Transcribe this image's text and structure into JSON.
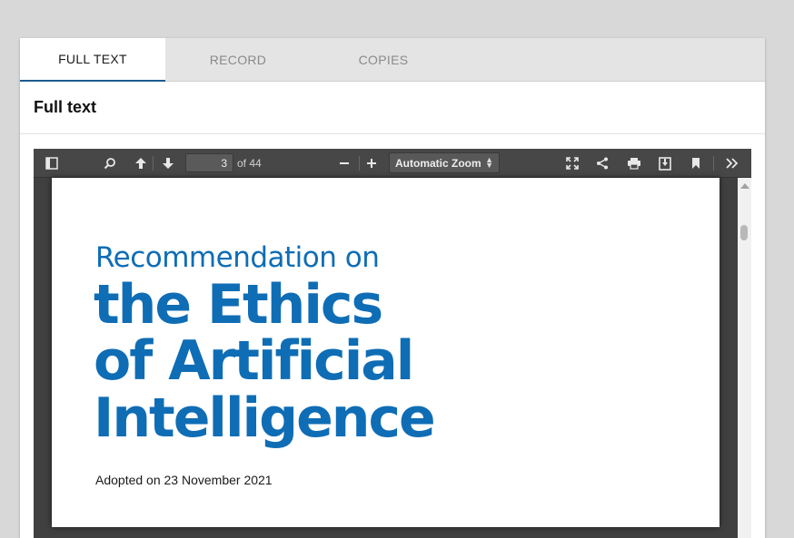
{
  "tabs": [
    {
      "label": "FULL TEXT",
      "active": true
    },
    {
      "label": "RECORD",
      "active": false
    },
    {
      "label": "COPIES",
      "active": false
    }
  ],
  "section": {
    "title": "Full text"
  },
  "viewer": {
    "toolbar": {
      "page_number": "3",
      "page_of": "of 44",
      "zoom": "Automatic Zoom",
      "icons": [
        "sidebar-toggle-icon",
        "search-icon",
        "previous-page-icon",
        "next-page-icon",
        "zoom-out-icon",
        "zoom-in-icon",
        "presentation-mode-icon",
        "share-icon",
        "print-icon",
        "download-icon",
        "bookmark-icon",
        "tools-icon"
      ]
    },
    "document": {
      "line1": "Recommendation on",
      "line2": "the Ethics",
      "line3": "of Artificial",
      "line4": "Intelligence",
      "adopted": "Adopted on 23 November 2021"
    }
  },
  "colors": {
    "accent_tab": "#1d5a8e",
    "title_blue": "#0f6db5",
    "toolbar_bg": "#474747"
  }
}
